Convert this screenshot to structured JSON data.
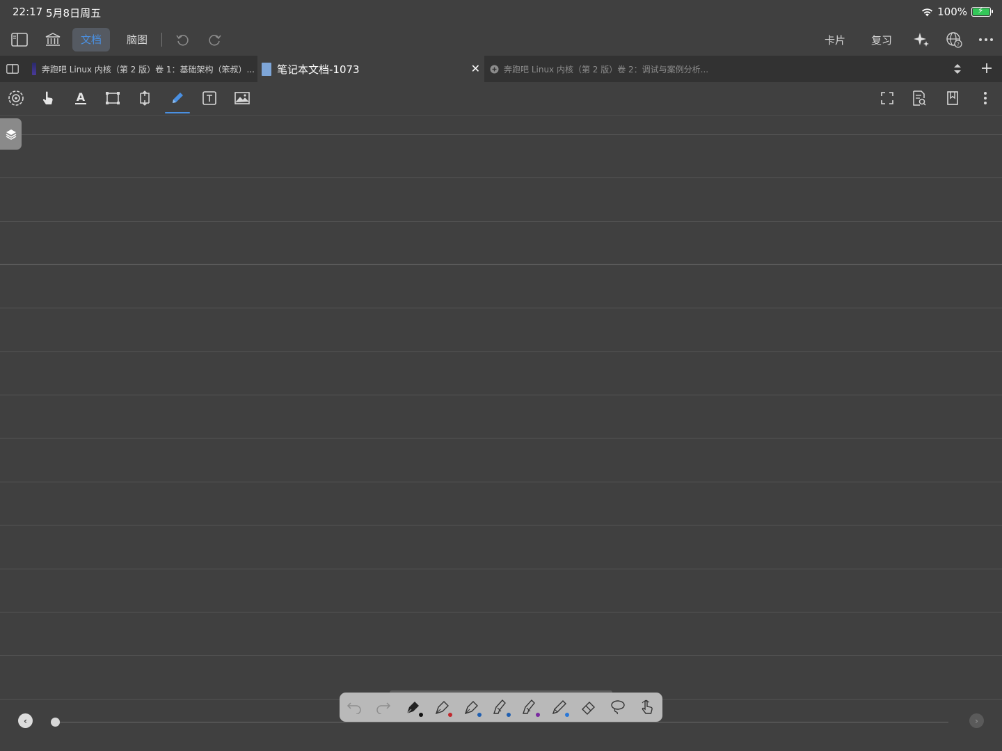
{
  "status_bar": {
    "time": "22:17",
    "date": "5月8日周五",
    "battery": "100%"
  },
  "nav": {
    "seg_document": "文档",
    "seg_mindmap": "脑图",
    "cards": "卡片",
    "review": "复习"
  },
  "tabs": [
    {
      "title": "奔跑吧 Linux 内核（第 2 版）卷 1：基础架构（笨叔）..."
    },
    {
      "title": "笔记本文档-1073"
    },
    {
      "title": "奔跑吧 Linux 内核（第 2 版）卷 2：调试与案例分析..."
    }
  ],
  "colors": {
    "accent": "#4a90e2",
    "background": "#404040",
    "tab_bar": "#323232",
    "palette": "#b9b9b9",
    "pen_black": "#111111",
    "pen_red": "#c0282d",
    "pen_blue": "#1f5fb0",
    "pen_purple": "#7a2aa0",
    "pen_light_blue": "#2a78d8",
    "battery_green": "#34c759"
  },
  "tools": [
    "settings-icon",
    "hand-icon",
    "text-highlight-icon",
    "select-rect-icon",
    "crop-icon",
    "pencil-icon",
    "text-box-icon",
    "image-icon"
  ],
  "palette_tools": [
    "undo-icon",
    "redo-icon",
    "fountain-pen-icon",
    "pen-icon",
    "pen-icon",
    "highlighter-icon",
    "highlighter-icon",
    "pencil-icon",
    "eraser-icon",
    "lasso-icon",
    "finger-icon"
  ]
}
